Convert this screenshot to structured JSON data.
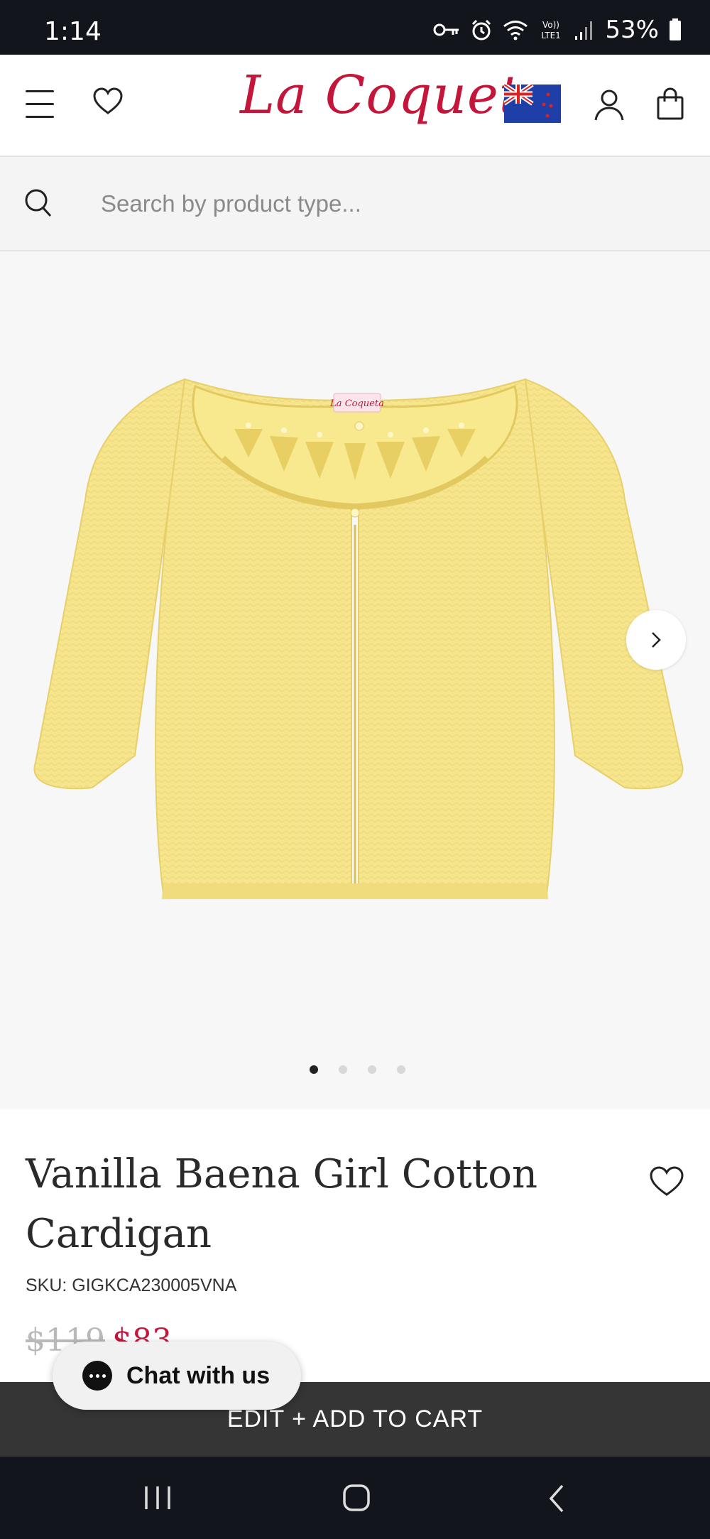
{
  "status_bar": {
    "time": "1:14",
    "battery": "53%",
    "icons": [
      "key-icon",
      "alarm-icon",
      "wifi-icon",
      "volte-icon",
      "signal-icon",
      "battery-icon"
    ]
  },
  "header": {
    "logo": "La Coqueta",
    "icons": [
      "menu-icon",
      "heart-icon",
      "nz-flag-icon",
      "account-icon",
      "bag-icon"
    ]
  },
  "search": {
    "placeholder": "Search by product type..."
  },
  "gallery": {
    "image_count": 4,
    "active_index": 0,
    "label_on_garment": "La Coqueta"
  },
  "product": {
    "title": "Vanilla Baena Girl Cotton Cardigan",
    "sku": "SKU: GIGKCA230005VNA",
    "price_old": "$119",
    "price_new": "$83"
  },
  "cart": {
    "label": "EDIT + ADD TO CART"
  },
  "chat": {
    "label": "Chat with us"
  },
  "colors": {
    "brand": "#c4163a",
    "cart_bar": "#353535",
    "system_bar": "#13151c",
    "cardigan": "#f6e58c"
  }
}
